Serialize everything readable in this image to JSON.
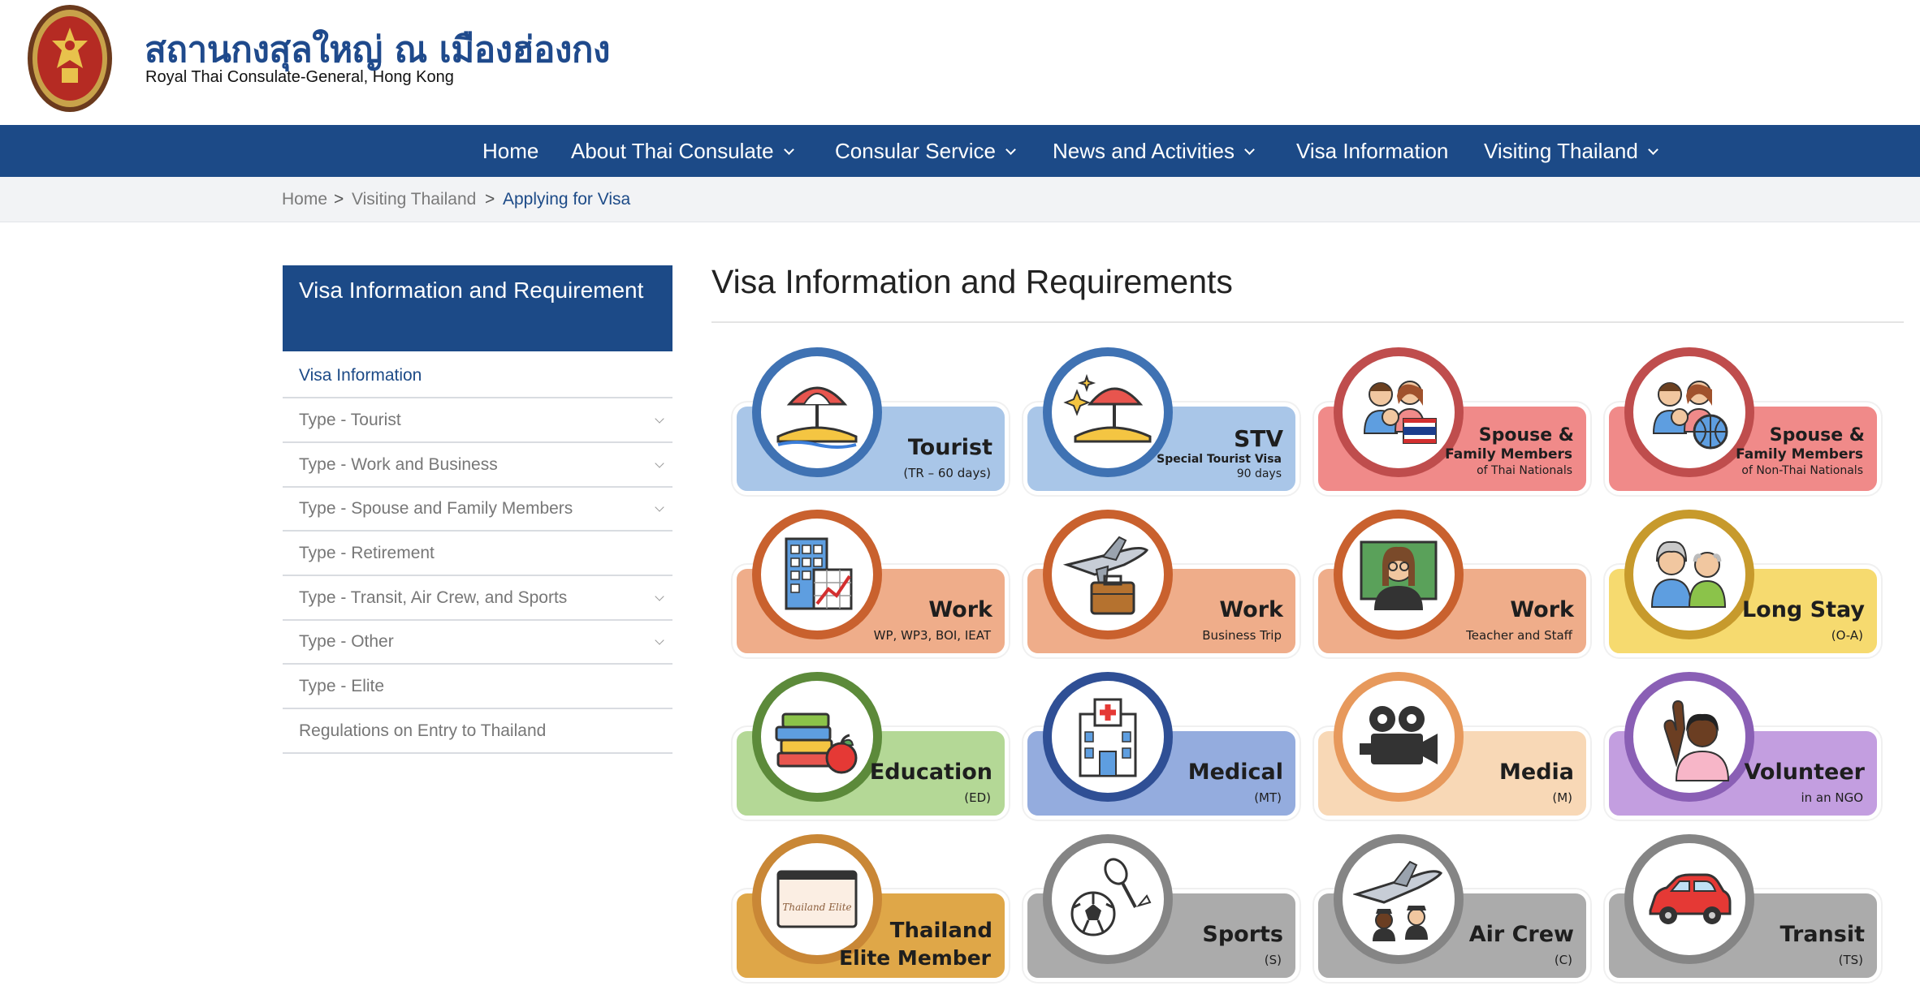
{
  "header": {
    "title_th": "สถานกงสุลใหญ่ ณ เมืองฮ่องกง",
    "title_en": "Royal Thai Consulate-General, Hong Kong"
  },
  "nav": {
    "items": [
      {
        "label": "Home"
      },
      {
        "label": "About Thai Consulate"
      },
      {
        "label": "Consular Service"
      },
      {
        "label": "News and Activities"
      },
      {
        "label": "Visa Information"
      },
      {
        "label": "Visiting Thailand"
      }
    ]
  },
  "breadcrumb": [
    "Home",
    "Visiting Thailand",
    "Applying for Visa"
  ],
  "sidebar": {
    "heading": "Visa Information and Requirement",
    "items": [
      {
        "label": "Visa Information"
      },
      {
        "label": "Type - Tourist"
      },
      {
        "label": "Type - Work and Business"
      },
      {
        "label": "Type - Spouse and Family Members"
      },
      {
        "label": "Type - Retirement"
      },
      {
        "label": "Type - Transit, Air Crew, and Sports"
      },
      {
        "label": "Type - Other"
      },
      {
        "label": "Type - Elite"
      },
      {
        "label": "Regulations on Entry to Thailand"
      }
    ]
  },
  "main": {
    "title": "Visa Information and Requirements",
    "cards": [
      {
        "title": "Tourist",
        "sub1": "(TR – 60 days)",
        "sub2": "",
        "icon": "beach-umbrella-icon",
        "fill": "#a9c6e8",
        "ring": "#3f72b3"
      },
      {
        "title": "STV",
        "sub1": "Special Tourist Visa",
        "sub2": "90 days",
        "icon": "beach-sparkle-icon",
        "fill": "#a9c6e8",
        "ring": "#3f72b3"
      },
      {
        "title": "Spouse &",
        "sub1": "Family Members",
        "sub2": "of Thai Nationals",
        "icon": "family-thai-flag-icon",
        "fill": "#f08a89",
        "ring": "#bf4d4d"
      },
      {
        "title": "Spouse &",
        "sub1": "Family Members",
        "sub2": "of Non-Thai Nationals",
        "icon": "family-globe-icon",
        "fill": "#f08a89",
        "ring": "#bf4d4d"
      },
      {
        "title": "Work",
        "sub1": "WP, WP3, BOI, IEAT",
        "sub2": "",
        "icon": "building-chart-icon",
        "fill": "#efad8a",
        "ring": "#c9612e"
      },
      {
        "title": "Work",
        "sub1": "Business Trip",
        "sub2": "",
        "icon": "plane-briefcase-icon",
        "fill": "#efad8a",
        "ring": "#c9612e"
      },
      {
        "title": "Work",
        "sub1": "Teacher and Staff",
        "sub2": "",
        "icon": "teacher-icon",
        "fill": "#efad8a",
        "ring": "#c9612e"
      },
      {
        "title": "Long Stay",
        "sub1": "(O-A)",
        "sub2": "",
        "icon": "elderly-couple-icon",
        "fill": "#f6da6f",
        "ring": "#c79a2c"
      },
      {
        "title": "Education",
        "sub1": "(ED)",
        "sub2": "",
        "icon": "books-apple-icon",
        "fill": "#b4d896",
        "ring": "#5c8a3a"
      },
      {
        "title": "Medical",
        "sub1": "(MT)",
        "sub2": "",
        "icon": "hospital-icon",
        "fill": "#94acde",
        "ring": "#2f4f95"
      },
      {
        "title": "Media",
        "sub1": "(M)",
        "sub2": "",
        "icon": "movie-camera-icon",
        "fill": "#f8d8b6",
        "ring": "#e7995c"
      },
      {
        "title": "Volunteer",
        "sub1": "in an NGO",
        "sub2": "",
        "icon": "raised-hand-icon",
        "fill": "#c39ee0",
        "ring": "#8a5fb5"
      },
      {
        "title": "Thailand",
        "sub1": "Elite Member",
        "sub2": "",
        "icon": "elite-card-icon",
        "fill": "#dfa748",
        "ring": "#c98736",
        "card_text": "Thailand Elite"
      },
      {
        "title": "Sports",
        "sub1": "(S)",
        "sub2": "",
        "icon": "sports-ball-racket-icon",
        "fill": "#ababab",
        "ring": "#858585"
      },
      {
        "title": "Air Crew",
        "sub1": "(C)",
        "sub2": "",
        "icon": "plane-crew-icon",
        "fill": "#ababab",
        "ring": "#858585"
      },
      {
        "title": "Transit",
        "sub1": "(TS)",
        "sub2": "",
        "icon": "car-icon",
        "fill": "#ababab",
        "ring": "#858585"
      }
    ]
  }
}
